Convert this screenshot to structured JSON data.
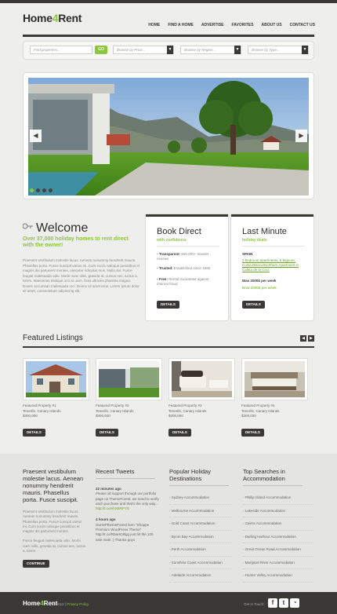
{
  "brand": {
    "name_part1": "Home",
    "name_part2": "4",
    "name_part3": "Rent"
  },
  "nav": [
    "Home",
    "Find a Home",
    "Advertise",
    "Favorites",
    "About Us",
    "Contact Us"
  ],
  "search": {
    "keyword_placeholder": "Find properties...",
    "go_label": "GO",
    "price_label": "Browse by Price...",
    "region_label": "Browse by Region...",
    "type_label": "Browse by Type..."
  },
  "welcome": {
    "title": "Welcome",
    "subtitle": "Over 37,000 holiday homes to rent direct with the owner!",
    "body": "Praesent vestibulum molestie lacus. Aenean nonummy hendrerit mauris. Phasellus porta. Fusce suscipit varius mi. Cum sociis natoque penatibus et magnis dis parturient montes, nascetur ridiculus mus. Nulla dui. Fusce feugiat malesuada odio. Morbi nunc odio, gravida at, cursus nec, luctus a, lorem. Maecenas tristique orci ac sem. Duis ultricies pharetra magna. Donec accumsan malesuada orci. Donec sit amet eros. Lorem ipsum dolor sit amet, consectetuer adipiscing elit."
  },
  "book_direct": {
    "title": "Book Direct",
    "subtitle": "with confidence",
    "features": [
      {
        "bold": "Transparent:",
        "text": "500,000+ traveler reviews"
      },
      {
        "bold": "Trusted:",
        "text": "Established since 1995"
      },
      {
        "bold": "Free:",
        "text": "Rental Guarantee against internet fraud"
      }
    ],
    "button": "DETAILS"
  },
  "last_minute": {
    "title": "Last Minute",
    "subtitle": "holiday deals",
    "country": "SPAIN",
    "desc1": "2 bedroom apartments, 5 Bigsure, Costa Blanca/Northern Apartment in Caleta de la Cruz",
    "rate": "Was 2000$ per week",
    "price": "Now 2000$ per week",
    "button": "DETAILS"
  },
  "featured": {
    "title": "Featured Listings",
    "prev_icon": "◀",
    "next_icon": "▶",
    "items": [
      {
        "name": "Featured Property #1",
        "location": "Tenerife, Canary Islands",
        "price": "$300,000",
        "button": "DETAILS"
      },
      {
        "name": "Featured Property #2",
        "location": "Tenerife, Canary Islands",
        "price": "$300,000",
        "button": "DETAILS"
      },
      {
        "name": "Featured Property #3",
        "location": "Tenerife, Canary Islands",
        "price": "$300,000",
        "button": "DETAILS"
      },
      {
        "name": "Featured Property #4",
        "location": "Tenerife, Canary Islands",
        "price": "$300,000",
        "button": "DETAILS"
      }
    ]
  },
  "footer": {
    "about_title": "Praesent vestibulum molestie lacus. Aenean nonummy hendrerit mauris. Phasellus porta. Fusce suscipit.",
    "about_body1": "Praesent vestibulum molestie lacus. Aenean nonummy hendrerit mauris. Phasellus porta. Fusce suscipit varius mi. Cum sociis natoque penatibus et magnis dis parturient montes.",
    "about_body2": "Fusce feugiat malesuada odio. Morbi nunc odio, gravida at, cursus nec, luctus a, lorem.",
    "continue": "CONTINUE",
    "tweets_title": "Recent Tweets",
    "tweets": [
      {
        "time": "22 minutes ago",
        "text": "Please all support through our portfolio page on ThemeForest, we need to verify each purchase and that's the only way...",
        "link": "http://t.co/ehXBRFVS"
      },
      {
        "time": "4 hours ago",
        "text": "OurWPthemeForest item \"Shoppe Premium WordPress Theme\" http://t.co/RbaHD8lgg just hit the 100 sale mark :)  Thanks guys",
        "link": ""
      }
    ],
    "popular_title": "Popular Holiday Destinations",
    "popular": [
      "Sydney Accommodation",
      "Melbourne Accommodation",
      "Gold Coast Accommodation",
      "Byron Bay Accommodation",
      "Perth Accommodation",
      "Sunshine Coast Accommodation",
      "Adelaide Accommodation"
    ],
    "searches_title": "Top Searches in Accommodation",
    "searches": [
      "Phillip Island Accommodation",
      "Lakeside Accommodation",
      "Cairns Accommodation",
      "Darling Harbour Accommodation",
      "Great Ocean Road Accommodation",
      "Margaret River Accommodation",
      "Hunter Valley Accommodation"
    ]
  },
  "bottom": {
    "logo_part1": "Home",
    "logo_part2": "4",
    "logo_part3": "Rent",
    "copyright": "© 2012 |",
    "privacy": "Privacy Policy",
    "get_in_touch": "Get in Touch:",
    "social": [
      {
        "icon": "facebook-icon",
        "glyph": "f"
      },
      {
        "icon": "twitter-icon",
        "glyph": "t"
      },
      {
        "icon": "rss-icon",
        "glyph": "◔"
      }
    ]
  },
  "colors": {
    "accent": "#8cc63f",
    "dark": "#3a3835",
    "background": "#eeeeec"
  }
}
